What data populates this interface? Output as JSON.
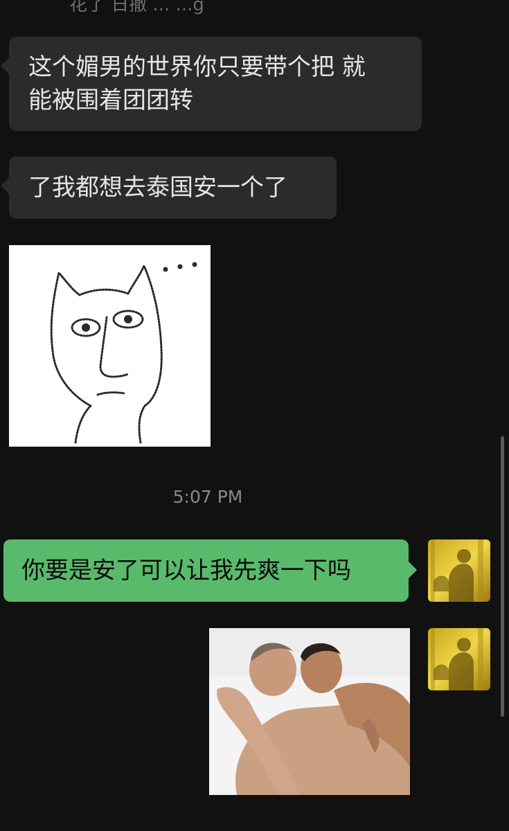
{
  "chat": {
    "top_partial_text": "花了 日撤 ... ...g",
    "messages": [
      {
        "direction": "incoming",
        "type": "text",
        "line1": "这个媚男的世界你只要带个把 就",
        "line2": "能被围着团团转"
      },
      {
        "direction": "incoming",
        "type": "text",
        "text": "了我都想去泰国安一个了"
      },
      {
        "direction": "incoming",
        "type": "sticker",
        "icon": "cat-face-sticker"
      },
      {
        "direction": "outgoing",
        "type": "text",
        "text": "你要是安了可以让我先爽一下吗"
      },
      {
        "direction": "outgoing",
        "type": "image",
        "icon": "embracing-photo"
      }
    ],
    "timestamp": "5:07 PM"
  },
  "colors": {
    "background": "#111111",
    "incoming_bubble": "#2b2b2b",
    "outgoing_bubble": "#5aba6c",
    "timestamp": "#8a8a8a"
  }
}
